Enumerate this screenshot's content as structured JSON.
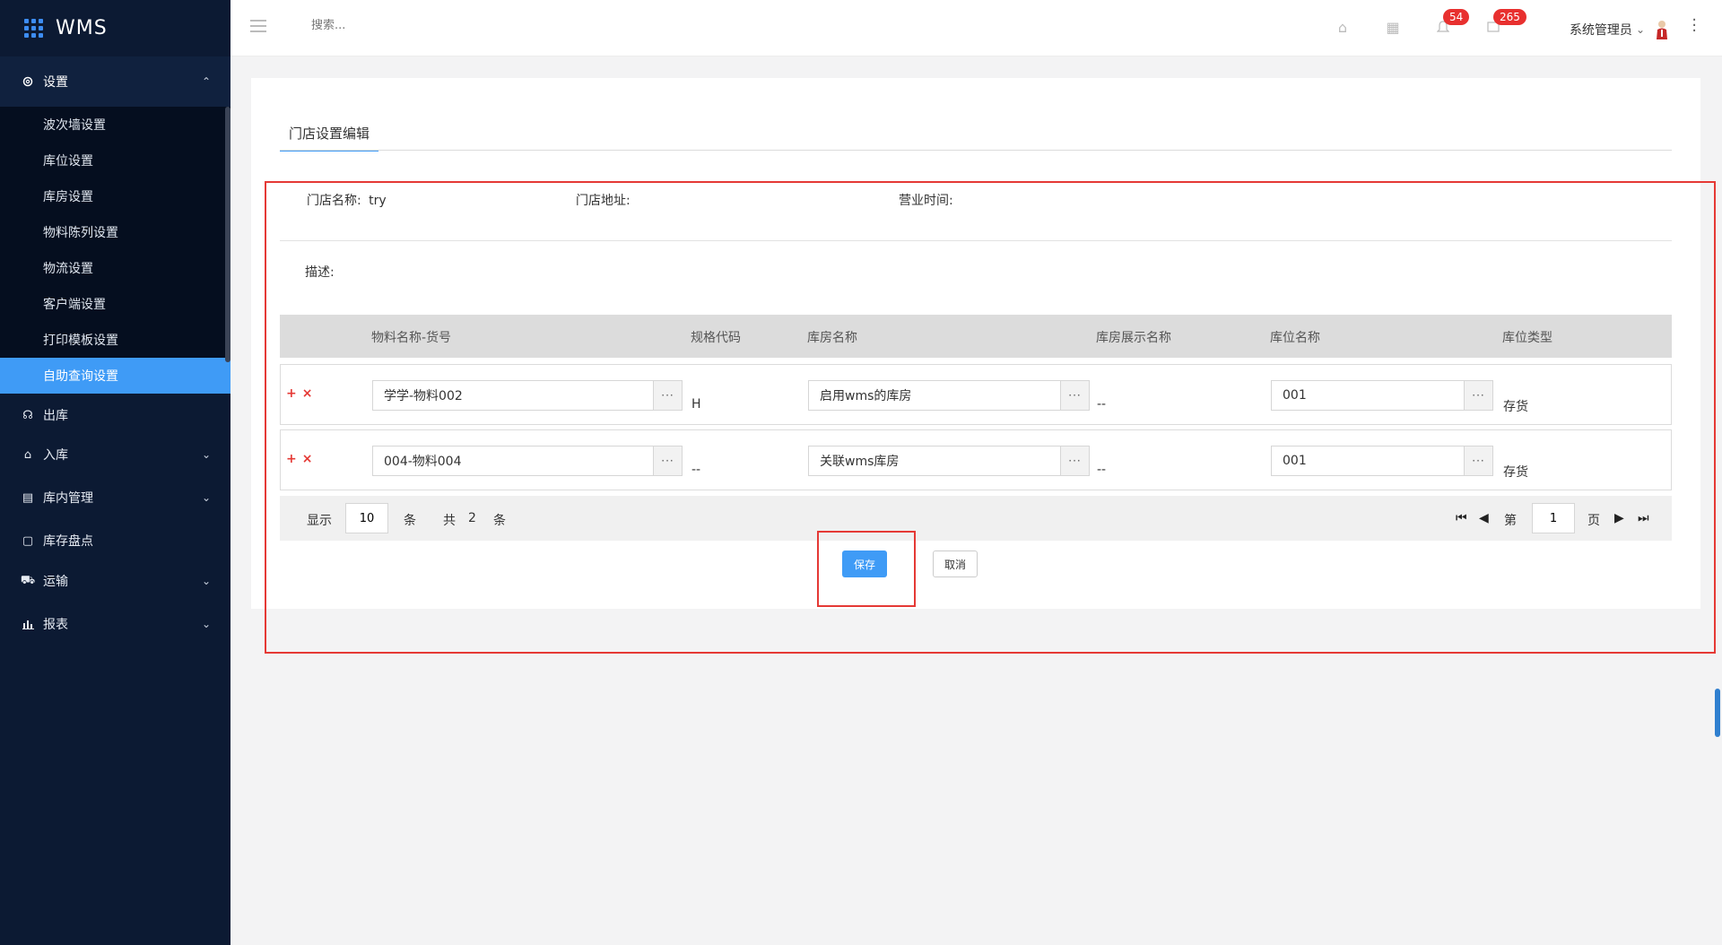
{
  "app": {
    "brand": "WMS"
  },
  "sidebar": {
    "group": {
      "label": "设置",
      "icon": "gear-icon",
      "expanded": true
    },
    "subitems": [
      {
        "label": "波次墙设置"
      },
      {
        "label": "库位设置"
      },
      {
        "label": "库房设置"
      },
      {
        "label": "物料陈列设置"
      },
      {
        "label": "物流设置"
      },
      {
        "label": "客户端设置"
      },
      {
        "label": "打印模板设置"
      },
      {
        "label": "自助查询设置",
        "active": true
      }
    ],
    "nav": [
      {
        "label": "出库",
        "icon": "headset-icon",
        "expandable": false
      },
      {
        "label": "入库",
        "icon": "home-icon",
        "expandable": true
      },
      {
        "label": "库内管理",
        "icon": "warehouse-icon",
        "expandable": true
      },
      {
        "label": "库存盘点",
        "icon": "clipboard-icon",
        "expandable": false
      },
      {
        "label": "运输",
        "icon": "truck-icon",
        "expandable": true
      },
      {
        "label": "报表",
        "icon": "bar-chart-icon",
        "expandable": true
      }
    ]
  },
  "topbar": {
    "search_placeholder": "搜索...",
    "notifications_count": "54",
    "messages_count": "265",
    "user_name": "系统管理员"
  },
  "page": {
    "tab_label": "门店设置编辑",
    "store_name_label": "门店名称:",
    "store_name_value": "try",
    "store_address_label": "门店地址:",
    "business_hours_label": "营业时间:",
    "description_label": "描述:"
  },
  "table": {
    "headers": [
      "物料名称-货号",
      "规格代码",
      "库房名称",
      "库房展示名称",
      "库位名称",
      "库位类型"
    ],
    "rows": [
      {
        "material": "学学-物料002",
        "spec": "H",
        "warehouse": "启用wms的库房",
        "warehouse_display": "--",
        "location": "001",
        "location_type": "存货"
      },
      {
        "material": "004-物料004",
        "spec": "--",
        "warehouse": "关联wms库房",
        "warehouse_display": "--",
        "location": "001",
        "location_type": "存货"
      }
    ],
    "add_symbol": "+",
    "remove_symbol": "×",
    "picker_symbol": "···"
  },
  "pagination": {
    "show_label": "显示",
    "page_size": "10",
    "unit1": "条",
    "total_label": "共",
    "total": "2",
    "unit2": "条",
    "page_prefix": "第",
    "current_page": "1",
    "page_suffix": "页"
  },
  "actions": {
    "save": "保存",
    "cancel": "取消"
  },
  "colors": {
    "accent": "#3f9bf6",
    "sidebar_bg": "#0c1a33",
    "highlight": "#e53935"
  }
}
